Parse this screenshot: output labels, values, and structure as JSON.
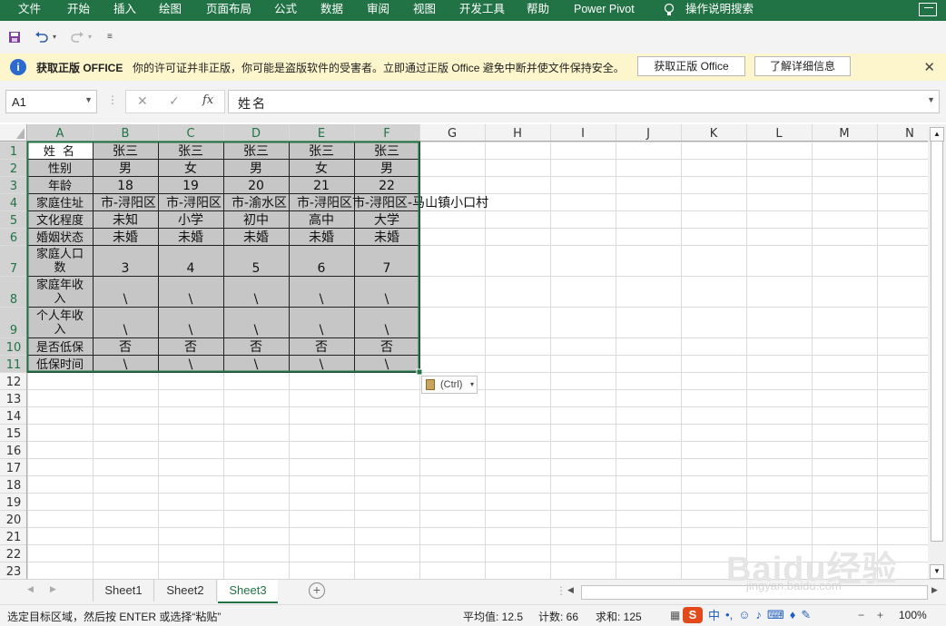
{
  "ribbon": {
    "tabs": [
      "文件",
      "开始",
      "插入",
      "绘图",
      "页面布局",
      "公式",
      "数据",
      "审阅",
      "视图",
      "开发工具",
      "帮助",
      "Power Pivot",
      "操作说明搜索"
    ],
    "bg_color": "#217346"
  },
  "quick_access": {
    "icons": [
      "save-icon",
      "undo-icon",
      "redo-icon",
      "customize-icon"
    ]
  },
  "license_bar": {
    "title": "获取正版 OFFICE",
    "message": "你的许可证并非正版，你可能是盗版软件的受害者。立即通过正版 Office 避免中断并使文件保持安全。",
    "button_get": "获取正版 Office",
    "button_learn": "了解详细信息"
  },
  "formula_bar": {
    "name_box": "A1",
    "fx_label": "fx",
    "value": "姓名"
  },
  "sheet": {
    "columns": [
      "A",
      "B",
      "C",
      "D",
      "E",
      "F",
      "G",
      "H",
      "I",
      "J",
      "K",
      "L",
      "M",
      "N"
    ],
    "rows": [
      "1",
      "2",
      "3",
      "4",
      "5",
      "6",
      "7",
      "8",
      "9",
      "10",
      "11",
      "12",
      "13",
      "14",
      "15",
      "16",
      "17",
      "18",
      "19",
      "20",
      "21",
      "22",
      "23"
    ],
    "table": [
      [
        "姓 名",
        "张三",
        "张三",
        "张三",
        "张三",
        "张三"
      ],
      [
        "性别",
        "男",
        "女",
        "男",
        "女",
        "男"
      ],
      [
        "年龄",
        "18",
        "19",
        "20",
        "21",
        "22"
      ],
      [
        "家庭住址",
        "市-浔阳区",
        "市-浔阳区",
        "市-渝水区",
        "市-浔阳区",
        "市-浔阳区-马山镇小口村"
      ],
      [
        "文化程度",
        "未知",
        "小学",
        "初中",
        "高中",
        "大学"
      ],
      [
        "婚姻状态",
        "未婚",
        "未婚",
        "未婚",
        "未婚",
        "未婚"
      ],
      [
        "家庭人口数",
        "3",
        "4",
        "5",
        "6",
        "7"
      ],
      [
        "家庭年收入",
        "\\",
        "\\",
        "\\",
        "\\",
        "\\"
      ],
      [
        "个人年收入",
        "\\",
        "\\",
        "\\",
        "\\",
        "\\"
      ],
      [
        "是否低保",
        "否",
        "否",
        "否",
        "否",
        "否"
      ],
      [
        "低保时间",
        "\\",
        "\\",
        "\\",
        "\\",
        "\\"
      ]
    ],
    "selection_color": "#c6c6c6",
    "accent_color": "#217346"
  },
  "paste_options": {
    "label": "(Ctrl)"
  },
  "sheet_tabs": [
    "Sheet1",
    "Sheet2",
    "Sheet3"
  ],
  "active_sheet": "Sheet3",
  "status_bar": {
    "message": "选定目标区域，然后按 ENTER 或选择“粘贴”",
    "average": "平均值: 12.5",
    "count": "计数: 66",
    "sum": "求和: 125",
    "zoom": "100%"
  },
  "watermark": {
    "text": "Baidu经验",
    "url_text": "jingyan.baidu.com"
  }
}
